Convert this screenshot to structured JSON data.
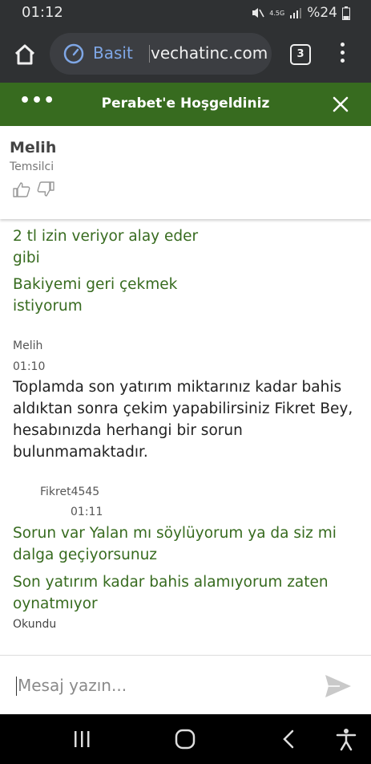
{
  "status": {
    "time": "01:12",
    "network": "4.5G",
    "battery": "%24"
  },
  "browser": {
    "mode_label": "Basit",
    "url": "vechatinc.com",
    "tab_count": "3"
  },
  "chat": {
    "header_title": "Perabet'e Hoşgeldiniz",
    "agent_name": "Melih",
    "agent_role": "Temsilci",
    "messages": [
      {
        "text_line1": "2 tl izin veriyor alay eder",
        "text_line2": "gibi"
      },
      {
        "text_line1": "Bakiyemi geri çekmek",
        "text_line2": "istiyorum"
      },
      {
        "sender": "Melih",
        "time": "01:10",
        "lines": [
          "Toplamda son yatırım miktarınız kadar bahis",
          "aldıktan sonra çekim yapabilirsiniz Fikret Bey,",
          "hesabınızda herhangi bir sorun",
          "bulunmamaktadır."
        ]
      },
      {
        "sender": "Fikret4545",
        "time": "01:11",
        "lines": [
          "Sorun var Yalan mı söylüyorum ya da siz mi",
          "dalga geçiyorsunuz"
        ]
      },
      {
        "lines": [
          "Son yatırım kadar bahis alamıyorum zaten",
          "oynatmıyor"
        ]
      }
    ],
    "read_status": "Okundu",
    "input_placeholder": "Mesaj yazın..."
  },
  "colors": {
    "brand_green": "#376b1f",
    "browser_bg": "#2f3133"
  }
}
